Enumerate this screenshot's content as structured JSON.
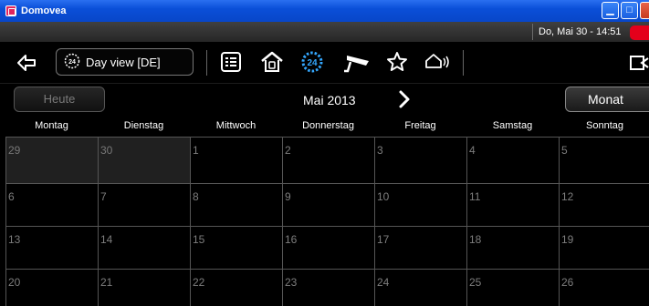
{
  "window": {
    "title": "Domovea"
  },
  "status": {
    "datetime": "Do, Mai 30 - 14:51"
  },
  "toolbar": {
    "view_label": "Day view [DE]",
    "view_badge": "24"
  },
  "calendar": {
    "today_label": "Heute",
    "month_label": "Mai 2013",
    "mode_label": "Monat",
    "weekdays": [
      "Montag",
      "Dienstag",
      "Mittwoch",
      "Donnerstag",
      "Freitag",
      "Samstag",
      "Sonntag"
    ],
    "weeks": [
      [
        "29",
        "30",
        "1",
        "2",
        "3",
        "4",
        "5"
      ],
      [
        "6",
        "7",
        "8",
        "9",
        "10",
        "11",
        "12"
      ],
      [
        "13",
        "14",
        "15",
        "16",
        "17",
        "18",
        "19"
      ],
      [
        "20",
        "21",
        "22",
        "23",
        "24",
        "25",
        "26"
      ]
    ],
    "previous_month_cells": [
      "29",
      "30"
    ]
  }
}
